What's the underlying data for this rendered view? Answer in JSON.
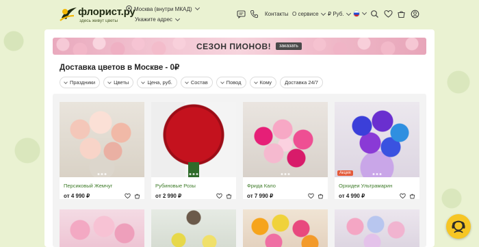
{
  "header": {
    "logo_text": "флорист.ру",
    "logo_tagline": "здесь живут цветы",
    "location": "Москва (внутри МКАД)",
    "address_prompt": "Укажите адрес",
    "contacts": "Контакты",
    "about": "О сервисе",
    "currency": "₽ Руб."
  },
  "banner": {
    "title": "СЕЗОН ПИОНОВ!",
    "button": "заказать"
  },
  "page_title": "Доставка цветов в Москве - 0₽",
  "filters": [
    {
      "label": "Праздники",
      "has_chevron": true
    },
    {
      "label": "Цветы",
      "has_chevron": true
    },
    {
      "label": "Цена, руб.",
      "has_chevron": true
    },
    {
      "label": "Состав",
      "has_chevron": true
    },
    {
      "label": "Повод",
      "has_chevron": true
    },
    {
      "label": "Кому",
      "has_chevron": true
    },
    {
      "label": "Доставка 24/7",
      "has_chevron": false
    }
  ],
  "products": [
    {
      "name": "Персиковый Жемчуг",
      "price": "от 4 990 ₽",
      "badge": ""
    },
    {
      "name": "Рубиновые Розы",
      "price": "от 2 990 ₽",
      "badge": ""
    },
    {
      "name": "Фрида Кало",
      "price": "от 7 990 ₽",
      "badge": ""
    },
    {
      "name": "Орхидеи Ультрамарин",
      "price": "от 4 990 ₽",
      "badge": "Акция"
    }
  ],
  "colors": {
    "page_bg": "#eaf2d2",
    "product_name": "#3c7a27",
    "promo_badge": "#e45a3a",
    "chat_button": "#f6c624"
  }
}
